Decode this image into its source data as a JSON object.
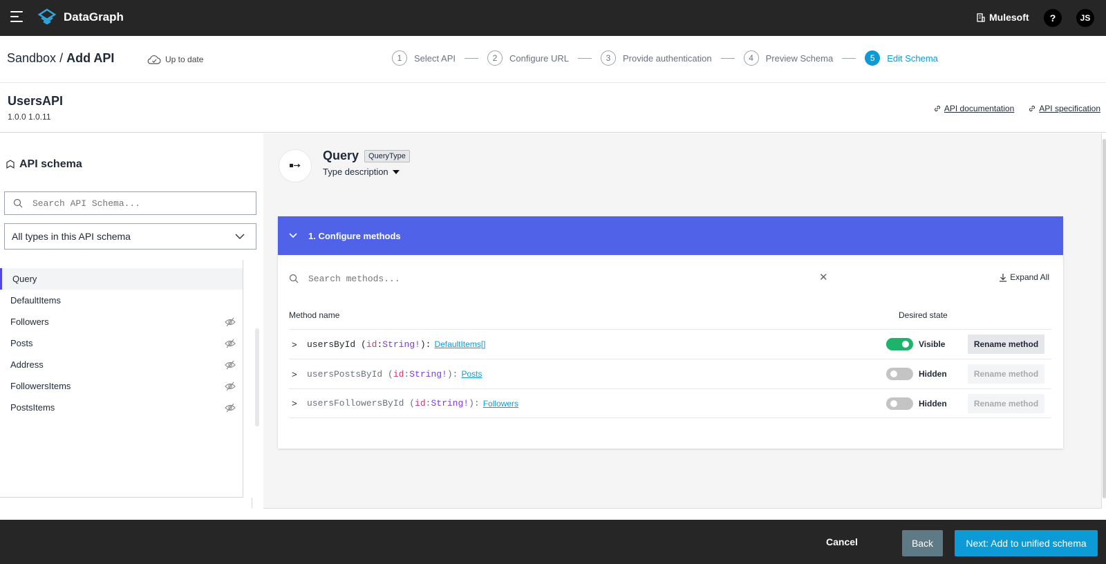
{
  "app": {
    "title": "DataGraph",
    "org": "Mulesoft",
    "help": "?",
    "user_initials": "JS"
  },
  "breadcrumb": {
    "env": "Sandbox",
    "sep": " / ",
    "page": "Add API"
  },
  "sync_status": "Up to date",
  "steps": [
    {
      "num": "1",
      "label": "Select API"
    },
    {
      "num": "2",
      "label": "Configure URL"
    },
    {
      "num": "3",
      "label": "Provide authentication"
    },
    {
      "num": "4",
      "label": "Preview Schema"
    },
    {
      "num": "5",
      "label": "Edit Schema",
      "active": true
    }
  ],
  "api": {
    "name": "UsersAPI",
    "version": "1.0.0 1.0.11",
    "doc_link": "API documentation",
    "spec_link": "API specification"
  },
  "schema_panel": {
    "title": "API schema",
    "search_placeholder": "Search API Schema...",
    "filter_value": "All types in this API schema",
    "types": [
      {
        "name": "Query",
        "active": true,
        "hidden_icon": false
      },
      {
        "name": "DefaultItems",
        "hidden_icon": false
      },
      {
        "name": "Followers",
        "hidden_icon": true
      },
      {
        "name": "Posts",
        "hidden_icon": true
      },
      {
        "name": "Address",
        "hidden_icon": true
      },
      {
        "name": "FollowersItems",
        "hidden_icon": true
      },
      {
        "name": "PostsItems",
        "hidden_icon": true
      }
    ]
  },
  "type_detail": {
    "name": "Query",
    "badge": "QueryType",
    "description_toggle": "Type description"
  },
  "methods": {
    "section_title": "1. Configure methods",
    "search_placeholder": "Search methods...",
    "expand_all": "Expand All",
    "col_method": "Method name",
    "col_state": "Desired state",
    "rows": [
      {
        "name": "usersById",
        "arg_key": "id",
        "arg_type": "String!",
        "returns": "DefaultItems[]",
        "state": "Visible",
        "enabled": true,
        "rename": "Rename method"
      },
      {
        "name": "usersPostsById",
        "arg_key": "id",
        "arg_type": "String!",
        "returns": "Posts",
        "state": "Hidden",
        "enabled": false,
        "rename": "Rename method"
      },
      {
        "name": "usersFollowersById",
        "arg_key": "id",
        "arg_type": "String!",
        "returns": "Followers",
        "state": "Hidden",
        "enabled": false,
        "rename": "Rename method"
      }
    ]
  },
  "footer": {
    "cancel": "Cancel",
    "back": "Back",
    "next": "Next: Add to unified schema"
  },
  "colors": {
    "accent": "#0d9bd7",
    "section_header": "#4f62e8",
    "toggle_on": "#1db36b",
    "topbar": "#262626"
  }
}
